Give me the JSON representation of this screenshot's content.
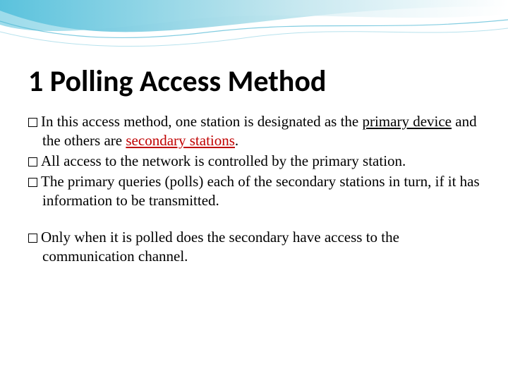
{
  "title": "1 Polling Access Method",
  "bullets": {
    "b1_pre": "In this access method, one station is designated as the ",
    "b1_primary": "primary device",
    "b1_mid": " and the others  are ",
    "b1_secondary": "secondary stations",
    "b1_post": ".",
    "b2": "All access to the network is controlled by the primary station.",
    "b3": "The primary queries (polls) each of the secondary stations in turn, if it has information to be transmitted.",
    "b4": "Only when it is polled does the secondary have access to the communication channel."
  }
}
